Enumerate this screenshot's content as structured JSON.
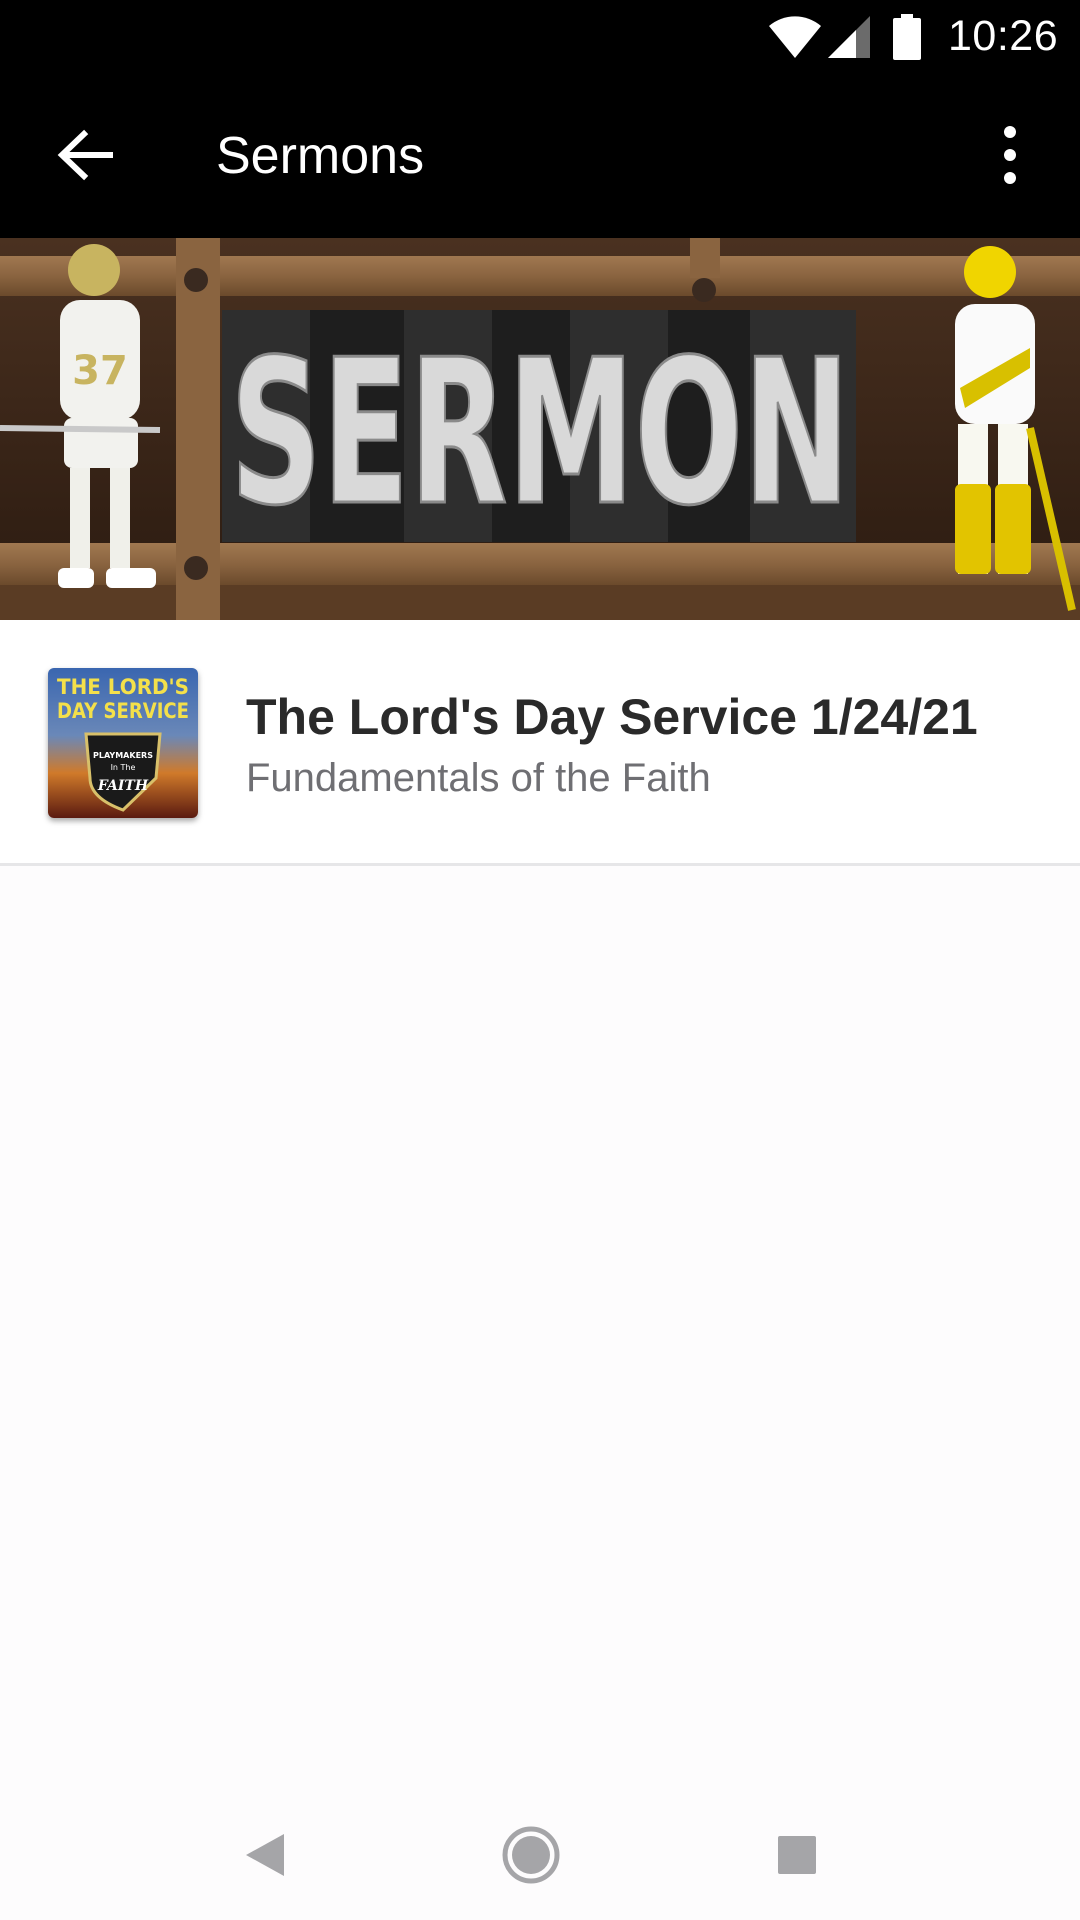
{
  "status_bar": {
    "time": "10:26",
    "icons": [
      "wifi-icon",
      "signal-icon",
      "battery-icon"
    ]
  },
  "toolbar": {
    "title": "Sermons",
    "back_icon": "arrow-left-icon",
    "menu_icon": "more-vertical-icon"
  },
  "banner": {
    "text": "SERMON"
  },
  "sermons": [
    {
      "title": "The Lord's Day Service 1/24/21",
      "subtitle": "Fundamentals of the Faith",
      "thumbnail_text": [
        "THE LORD'S",
        "DAY SERVICE"
      ],
      "badge_text": [
        "PLAYMAKERS",
        "In The",
        "FAITH"
      ]
    }
  ],
  "nav_bar": {
    "icons": [
      "back-triangle-icon",
      "home-circle-icon",
      "recents-square-icon"
    ]
  },
  "colors": {
    "bar_background": "#000000",
    "page_background": "#fdfcfd",
    "title_text": "#2a2a2a",
    "subtitle_text": "#6f6f73",
    "divider": "#e6e6e8"
  }
}
